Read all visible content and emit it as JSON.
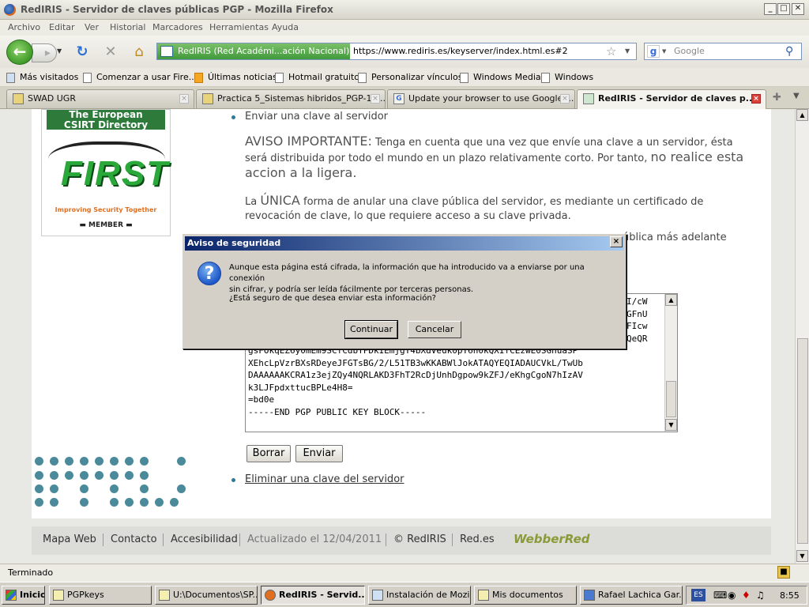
{
  "window": {
    "title": "RedIRIS - Servidor de claves públicas PGP - Mozilla Firefox",
    "minimize": "_",
    "maximize": "□",
    "close": "✕"
  },
  "menu": [
    "Archivo",
    "Editar",
    "Ver",
    "Historial",
    "Marcadores",
    "Herramientas",
    "Ayuda"
  ],
  "nav": {
    "identity_label": "RedIRIS (Red Académi...ación Nacional) (ES)",
    "url": "https://www.rediris.es/keyserver/index.html.es#2",
    "search_placeholder": "Google"
  },
  "bookmarks": [
    "Más visitados",
    "Comenzar a usar Fire...",
    "Últimas noticias",
    "Hotmail gratuito",
    "Personalizar vínculos",
    "Windows Media",
    "Windows"
  ],
  "tabs": [
    {
      "label": "SWAD UGR"
    },
    {
      "label": "Practica 5_Sistemas hibridos_PGP-1.p..."
    },
    {
      "label": "Update your browser to use Google ..."
    },
    {
      "label": "RedIRIS - Servidor de claves p..."
    }
  ],
  "sidebar_logo": {
    "csirt_line1": "The European",
    "csirt_line2": "CSIRT Directory",
    "first_word": "FIRST",
    "tagline": "Improving Security Together",
    "member": "MEMBER"
  },
  "page": {
    "send_key_item": "Enviar una clave al servidor",
    "warning_label": "AVISO IMPORTANTE:",
    "warning_text_1": " Tenga en cuenta que una vez que envíe una clave a un servidor, ésta",
    "warning_text_2": "será distribuida por todo el mundo en un plazo relativamente corto. Por tanto, ",
    "warning_emph": "no realice esta",
    "warning_text_3": "accion a la ligera.",
    "unica_text_1": "La ",
    "unica_word": "ÚNICA",
    "unica_text_2": " forma de anular una clave pública del servidor, es mediante un certificado de",
    "unica_text_3": "revocación de clave, lo que requiere acceso a su clave privada.",
    "partial_behind_dialog": "ública más adelante",
    "key_lines_right": [
      "I/cW",
      "GFnU",
      "FIcw",
      "QeQR"
    ],
    "key_text": "gsFOkqEZ6y0mEm9SCfCdbTFDkIEmjgT4bXdVeuk0pT6n0kQXIfCEzwE0SGhuaSP\nXEhcLpVzrBXsRDeyeJFGTsBG/2/L51TB3wKKABWlJokATAQYEQIADAUCVkL/TwUb\nDAAAAAAKCRA1z3ejZQy4NQRLAKD3FhT2RcDjUnhDgpow9kZFJ/eKhgCgoN7hIzAV\nk3LJFpdxttucBPLe4H8=\n=bd0e\n-----END PGP PUBLIC KEY BLOCK-----",
    "btn_borrar": "Borrar",
    "btn_enviar": "Enviar",
    "delete_key_link": "Eliminar una clave del servidor"
  },
  "footer": {
    "links": [
      "Mapa Web",
      "Contacto",
      "Accesibilidad"
    ],
    "updated": "Actualizado el 12/04/2011",
    "copyright": "© RedIRIS",
    "redes": "Red.es",
    "webber": "WebberRed"
  },
  "status": "Terminado",
  "dialog": {
    "title": "Aviso de seguridad",
    "message_line1": "Aunque esta página está cifrada, la información que ha introducido va a enviarse por una conexión",
    "message_line2": "sin cifrar, y podría ser leída fácilmente por terceras personas.",
    "question": "¿Está seguro de que desea enviar esta información?",
    "continue": "Continuar",
    "cancel": "Cancelar"
  },
  "taskbar": {
    "start": "Inicio",
    "items": [
      "PGPkeys",
      "U:\\Documentos\\SP...",
      "RedIRIS - Servid...",
      "Instalación de Mozi...",
      "Mis documentos",
      "Rafael Lachica Gar..."
    ],
    "lang": "ES",
    "clock": "8:55"
  }
}
